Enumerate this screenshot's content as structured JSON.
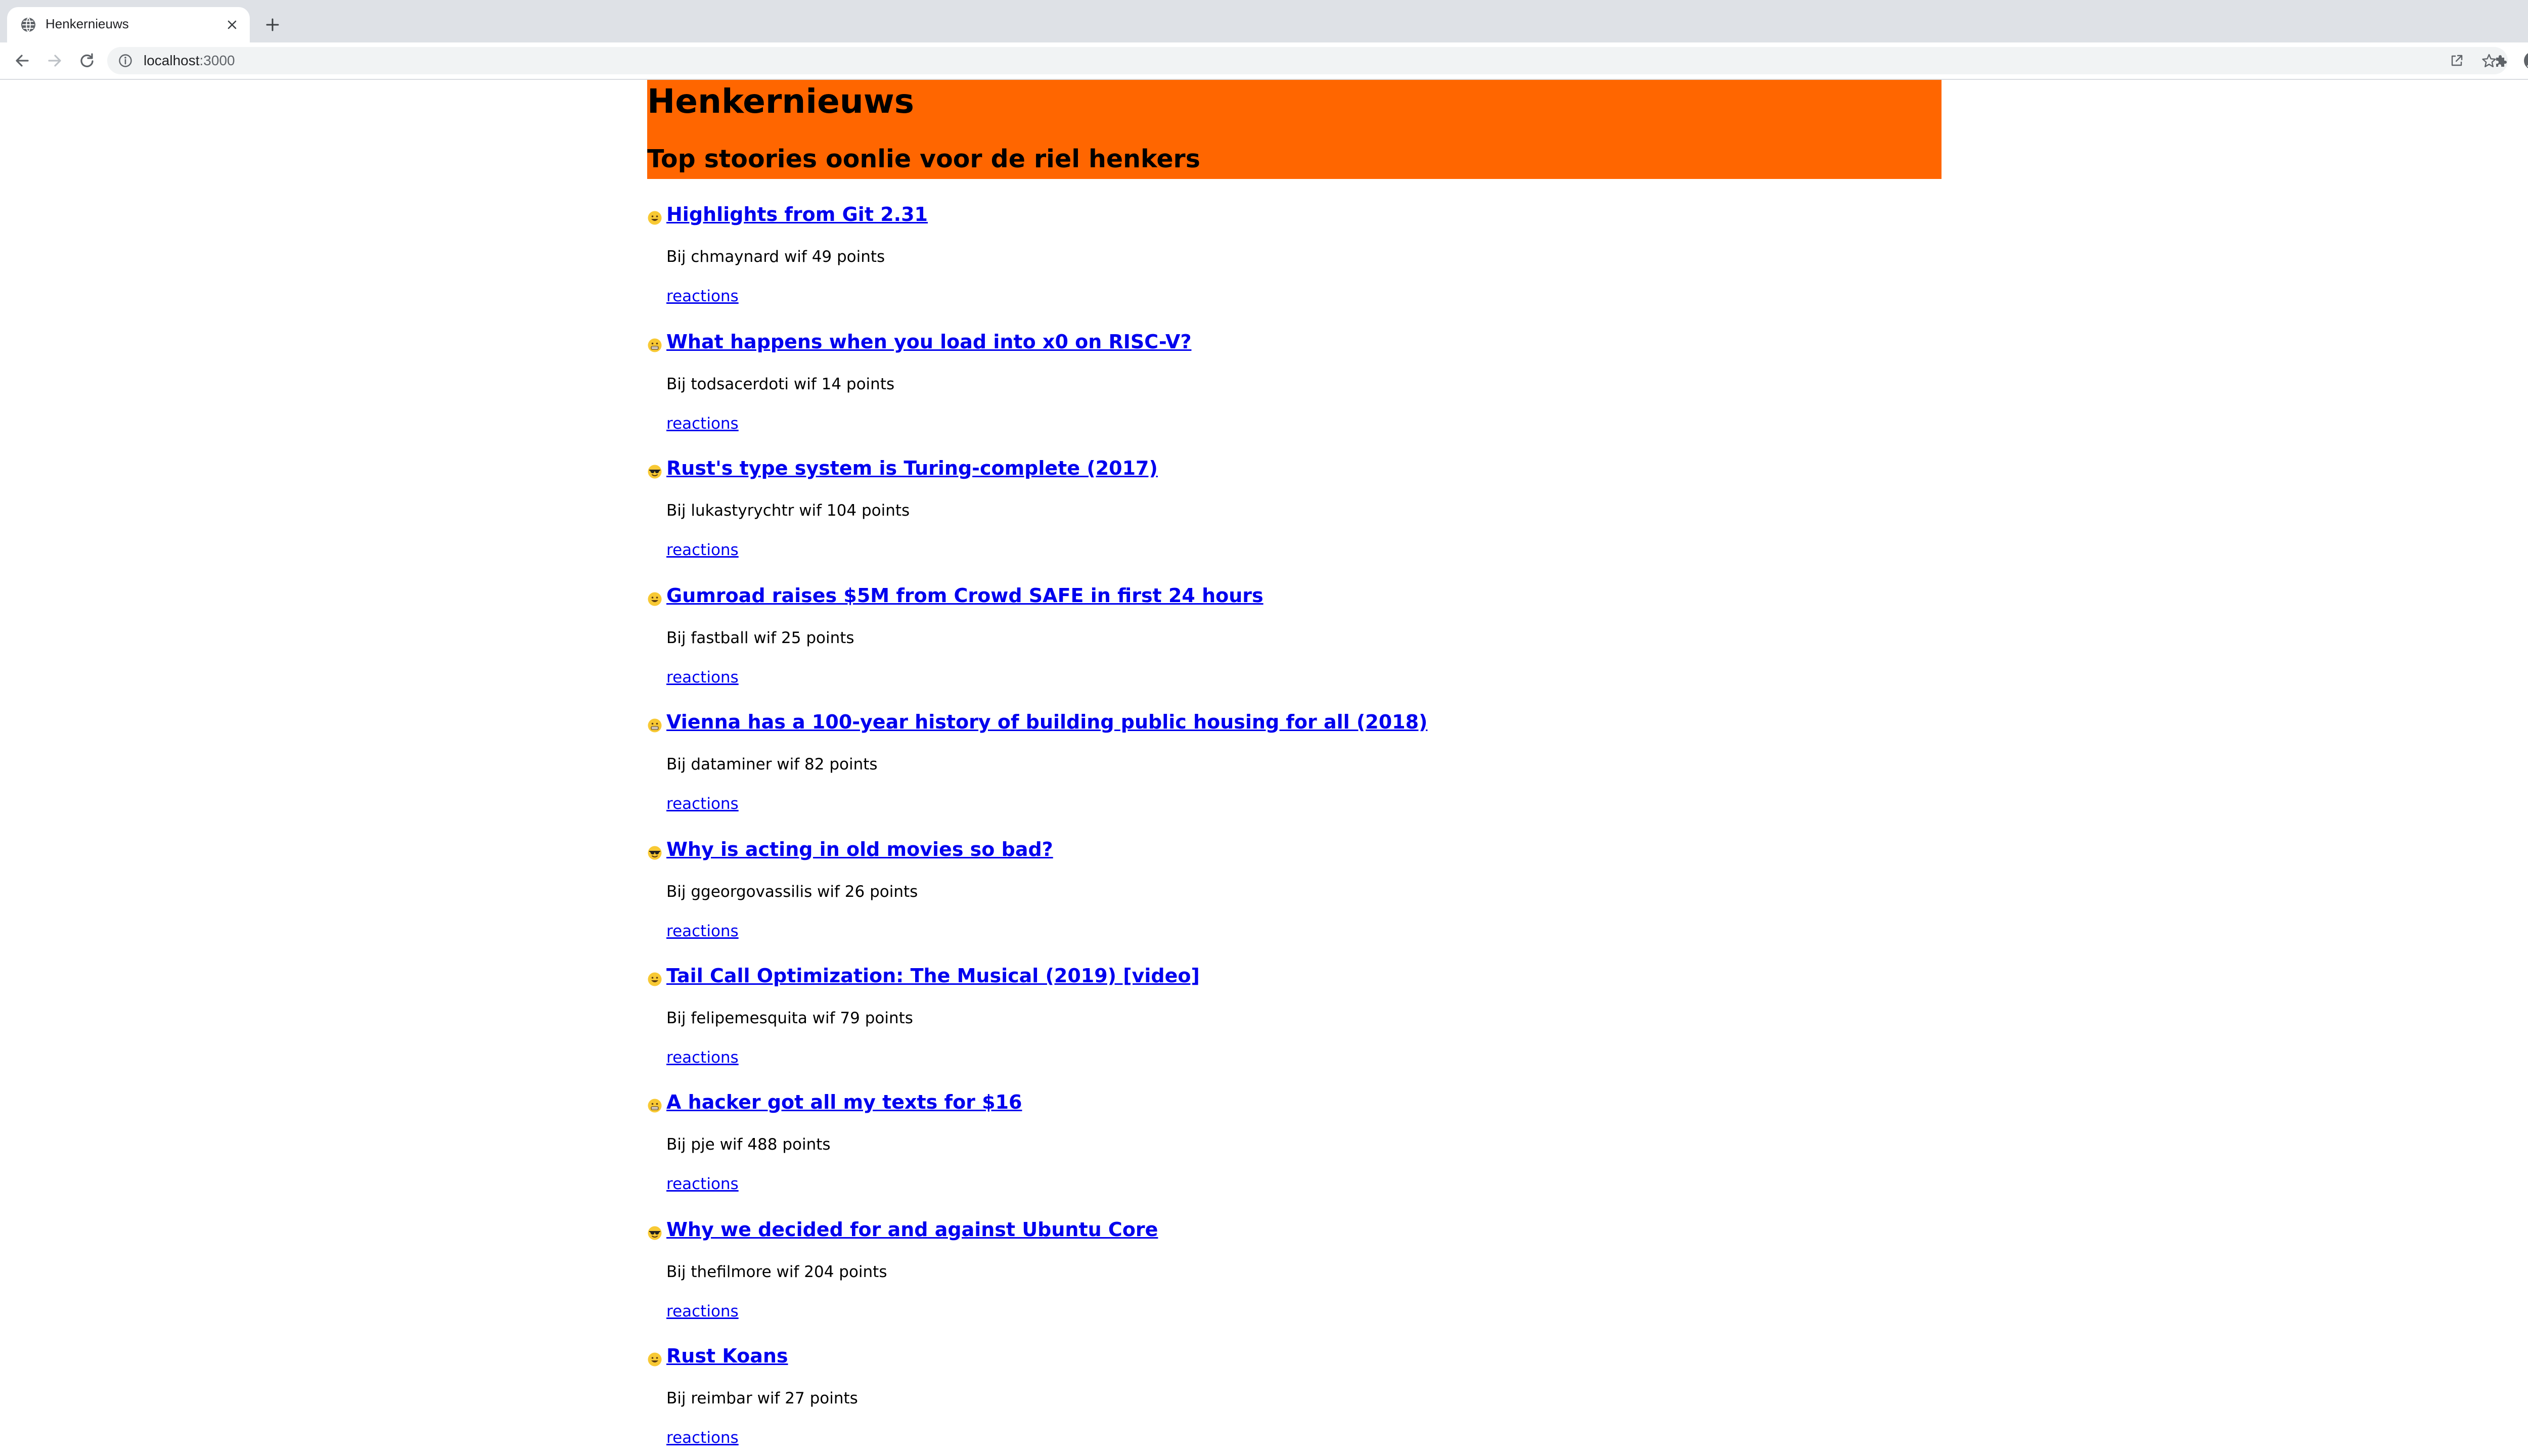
{
  "browser": {
    "tab_title": "Henkernieuws",
    "url_host": "localhost",
    "url_path": ":3000"
  },
  "header": {
    "title": "Henkernieuws",
    "subtitle": "Top stoories oonlie voor de riel henkers"
  },
  "stories": [
    {
      "title": "Highlights from Git 2.31",
      "meta": "Bij chmaynard wif 49 points",
      "reactions": "reactions",
      "emoji": "grin"
    },
    {
      "title": "What happens when you load into x0 on RISC-V?",
      "meta": "Bij todsacerdoti wif 14 points",
      "reactions": "reactions",
      "emoji": "grimace"
    },
    {
      "title": "Rust's type system is Turing-complete (2017)",
      "meta": "Bij lukastyrychtr wif 104 points",
      "reactions": "reactions",
      "emoji": "sunglasses"
    },
    {
      "title": "Gumroad raises $5M from Crowd SAFE in first 24 hours",
      "meta": "Bij fastball wif 25 points",
      "reactions": "reactions",
      "emoji": "grin"
    },
    {
      "title": "Vienna has a 100-year history of building public housing for all (2018)",
      "meta": "Bij dataminer wif 82 points",
      "reactions": "reactions",
      "emoji": "grimace"
    },
    {
      "title": "Why is acting in old movies so bad?",
      "meta": "Bij ggeorgovassilis wif 26 points",
      "reactions": "reactions",
      "emoji": "sunglasses"
    },
    {
      "title": "Tail Call Optimization: The Musical (2019) [video]",
      "meta": "Bij felipemesquita wif 79 points",
      "reactions": "reactions",
      "emoji": "grin"
    },
    {
      "title": "A hacker got all my texts for $16",
      "meta": "Bij pje wif 488 points",
      "reactions": "reactions",
      "emoji": "grimace"
    },
    {
      "title": "Why we decided for and against Ubuntu Core",
      "meta": "Bij thefilmore wif 204 points",
      "reactions": "reactions",
      "emoji": "sunglasses"
    },
    {
      "title": "Rust Koans",
      "meta": "Bij reimbar wif 27 points",
      "reactions": "reactions",
      "emoji": "grin"
    }
  ]
}
